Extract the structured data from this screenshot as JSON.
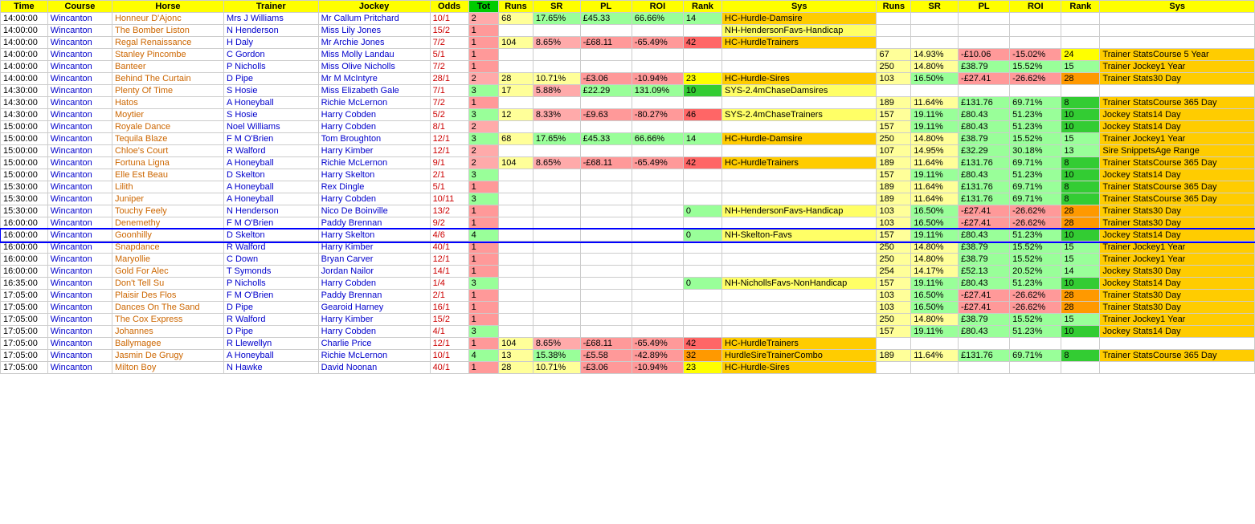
{
  "headers": {
    "time": "Time",
    "course": "Course",
    "horse": "Horse",
    "trainer": "Trainer",
    "jockey": "Jockey",
    "odds": "Odds",
    "tot": "Tot",
    "runs1": "Runs",
    "sr1": "SR",
    "pl1": "PL",
    "roi1": "ROI",
    "rank1": "Rank",
    "sys1": "Sys",
    "runs2": "Runs",
    "sr2": "SR",
    "pl2": "PL",
    "roi2": "ROI",
    "rank2": "Rank",
    "sys2": "Sys"
  },
  "rows": [
    {
      "time": "14:00:00",
      "course": "Wincanton",
      "horse": "Honneur D'Ajonc",
      "trainer": "Mrs J Williams",
      "jockey": "Mr Callum Pritchard",
      "odds": "10/1",
      "tot": "2",
      "tot_class": "tot-salmon",
      "runs1": "68",
      "sr1": "17.65%",
      "pl1": "£45.33",
      "roi1": "66.66%",
      "rank1": "14",
      "sys1": "HC-Hurdle-Damsire",
      "runs2": "",
      "sr2": "",
      "pl2": "",
      "roi2": "",
      "rank2": "",
      "sys2": ""
    },
    {
      "time": "14:00:00",
      "course": "Wincanton",
      "horse": "The Bomber Liston",
      "trainer": "N Henderson",
      "jockey": "Miss Lily Jones",
      "odds": "15/2",
      "tot": "1",
      "tot_class": "tot-salmon",
      "runs1": "",
      "sr1": "",
      "pl1": "",
      "roi1": "",
      "rank1": "",
      "sys1": "NH-HendersonFavs-Handicap",
      "runs2": "",
      "sr2": "",
      "pl2": "",
      "roi2": "",
      "rank2": "",
      "sys2": ""
    },
    {
      "time": "14:00:00",
      "course": "Wincanton",
      "horse": "Regal Renaissance",
      "trainer": "H Daly",
      "jockey": "Mr Archie Jones",
      "odds": "7/2",
      "tot": "1",
      "tot_class": "tot-salmon",
      "runs1": "104",
      "sr1": "8.65%",
      "pl1": "-£68.11",
      "roi1": "-65.49%",
      "rank1": "42",
      "sys1": "HC-HurdleTrainers",
      "runs2": "",
      "sr2": "",
      "pl2": "",
      "roi2": "",
      "rank2": "",
      "sys2": ""
    },
    {
      "time": "14:00:00",
      "course": "Wincanton",
      "horse": "Stanley Pincombe",
      "trainer": "C Gordon",
      "jockey": "Miss Molly Landau",
      "odds": "5/1",
      "tot": "1",
      "tot_class": "tot-salmon",
      "runs1": "",
      "sr1": "",
      "pl1": "",
      "roi1": "",
      "rank1": "",
      "sys1": "",
      "runs2": "67",
      "sr2": "14.93%",
      "pl2": "-£10.06",
      "roi2": "-15.02%",
      "rank2": "24",
      "sys2": "Trainer StatsCourse 5 Year"
    },
    {
      "time": "14:00:00",
      "course": "Wincanton",
      "horse": "Banteer",
      "trainer": "P Nicholls",
      "jockey": "Miss Olive Nicholls",
      "odds": "7/2",
      "tot": "1",
      "tot_class": "tot-salmon",
      "runs1": "",
      "sr1": "",
      "pl1": "",
      "roi1": "",
      "rank1": "",
      "sys1": "",
      "runs2": "250",
      "sr2": "14.80%",
      "pl2": "£38.79",
      "roi2": "15.52%",
      "rank2": "15",
      "sys2": "Trainer Jockey1 Year"
    },
    {
      "time": "14:00:00",
      "course": "Wincanton",
      "horse": "Behind The Curtain",
      "trainer": "D Pipe",
      "jockey": "Mr M McIntyre",
      "odds": "28/1",
      "tot": "2",
      "tot_class": "tot-salmon",
      "runs1": "28",
      "sr1": "10.71%",
      "pl1": "-£3.06",
      "roi1": "-10.94%",
      "rank1": "23",
      "sys1": "HC-Hurdle-Sires",
      "runs2": "103",
      "sr2": "16.50%",
      "pl2": "-£27.41",
      "roi2": "-26.62%",
      "rank2": "28",
      "sys2": "Trainer Stats30 Day"
    },
    {
      "time": "14:30:00",
      "course": "Wincanton",
      "horse": "Plenty Of Time",
      "trainer": "S Hosie",
      "jockey": "Miss Elizabeth Gale",
      "odds": "7/1",
      "tot": "3",
      "tot_class": "tot-green",
      "runs1": "17",
      "sr1": "5.88%",
      "pl1": "£22.29",
      "roi1": "131.09%",
      "rank1": "10",
      "sys1": "SYS-2.4mChaseDamsires",
      "runs2": "",
      "sr2": "",
      "pl2": "",
      "roi2": "",
      "rank2": "",
      "sys2": ""
    },
    {
      "time": "14:30:00",
      "course": "Wincanton",
      "horse": "Hatos",
      "trainer": "A Honeyball",
      "jockey": "Richie McLernon",
      "odds": "7/2",
      "tot": "1",
      "tot_class": "tot-salmon",
      "runs1": "",
      "sr1": "",
      "pl1": "",
      "roi1": "",
      "rank1": "",
      "sys1": "",
      "runs2": "189",
      "sr2": "11.64%",
      "pl2": "£131.76",
      "roi2": "69.71%",
      "rank2": "8",
      "sys2": "Trainer StatsCourse 365 Day"
    },
    {
      "time": "14:30:00",
      "course": "Wincanton",
      "horse": "Moytier",
      "trainer": "S Hosie",
      "jockey": "Harry Cobden",
      "odds": "5/2",
      "tot": "3",
      "tot_class": "tot-green",
      "runs1": "12",
      "sr1": "8.33%",
      "pl1": "-£9.63",
      "roi1": "-80.27%",
      "rank1": "46",
      "sys1": "SYS-2.4mChaseTrainers",
      "runs2": "157",
      "sr2": "19.11%",
      "pl2": "£80.43",
      "roi2": "51.23%",
      "rank2": "10",
      "sys2": "Jockey Stats14 Day"
    },
    {
      "time": "15:00:00",
      "course": "Wincanton",
      "horse": "Royale Dance",
      "trainer": "Noel Williams",
      "jockey": "Harry Cobden",
      "odds": "8/1",
      "tot": "2",
      "tot_class": "tot-salmon",
      "runs1": "",
      "sr1": "",
      "pl1": "",
      "roi1": "",
      "rank1": "",
      "sys1": "",
      "runs2": "157",
      "sr2": "19.11%",
      "pl2": "£80.43",
      "roi2": "51.23%",
      "rank2": "10",
      "sys2": "Jockey Stats14 Day"
    },
    {
      "time": "15:00:00",
      "course": "Wincanton",
      "horse": "Tequila Blaze",
      "trainer": "F M O'Brien",
      "jockey": "Tom Broughton",
      "odds": "12/1",
      "tot": "3",
      "tot_class": "tot-green",
      "runs1": "68",
      "sr1": "17.65%",
      "pl1": "£45.33",
      "roi1": "66.66%",
      "rank1": "14",
      "sys1": "HC-Hurdle-Damsire",
      "runs2": "250",
      "sr2": "14.80%",
      "pl2": "£38.79",
      "roi2": "15.52%",
      "rank2": "15",
      "sys2": "Trainer Jockey1 Year"
    },
    {
      "time": "15:00:00",
      "course": "Wincanton",
      "horse": "Chloe's Court",
      "trainer": "R Walford",
      "jockey": "Harry Kimber",
      "odds": "12/1",
      "tot": "2",
      "tot_class": "tot-salmon",
      "runs1": "",
      "sr1": "",
      "pl1": "",
      "roi1": "",
      "rank1": "",
      "sys1": "",
      "runs2": "107",
      "sr2": "14.95%",
      "pl2": "£32.29",
      "roi2": "30.18%",
      "rank2": "13",
      "sys2": "Sire SnippetsAge Range"
    },
    {
      "time": "15:00:00",
      "course": "Wincanton",
      "horse": "Fortuna Ligna",
      "trainer": "A Honeyball",
      "jockey": "Richie McLernon",
      "odds": "9/1",
      "tot": "2",
      "tot_class": "tot-salmon",
      "runs1": "104",
      "sr1": "8.65%",
      "pl1": "-£68.11",
      "roi1": "-65.49%",
      "rank1": "42",
      "sys1": "HC-HurdleTrainers",
      "runs2": "189",
      "sr2": "11.64%",
      "pl2": "£131.76",
      "roi2": "69.71%",
      "rank2": "8",
      "sys2": "Trainer StatsCourse 365 Day"
    },
    {
      "time": "15:00:00",
      "course": "Wincanton",
      "horse": "Elle Est Beau",
      "trainer": "D Skelton",
      "jockey": "Harry Skelton",
      "odds": "2/1",
      "tot": "3",
      "tot_class": "tot-green",
      "runs1": "",
      "sr1": "",
      "pl1": "",
      "roi1": "",
      "rank1": "",
      "sys1": "",
      "runs2": "157",
      "sr2": "19.11%",
      "pl2": "£80.43",
      "roi2": "51.23%",
      "rank2": "10",
      "sys2": "Jockey Stats14 Day"
    },
    {
      "time": "15:30:00",
      "course": "Wincanton",
      "horse": "Lilith",
      "trainer": "A Honeyball",
      "jockey": "Rex Dingle",
      "odds": "5/1",
      "tot": "1",
      "tot_class": "tot-salmon",
      "runs1": "",
      "sr1": "",
      "pl1": "",
      "roi1": "",
      "rank1": "",
      "sys1": "",
      "runs2": "189",
      "sr2": "11.64%",
      "pl2": "£131.76",
      "roi2": "69.71%",
      "rank2": "8",
      "sys2": "Trainer StatsCourse 365 Day"
    },
    {
      "time": "15:30:00",
      "course": "Wincanton",
      "horse": "Juniper",
      "trainer": "A Honeyball",
      "jockey": "Harry Cobden",
      "odds": "10/11",
      "tot": "3",
      "tot_class": "tot-green",
      "runs1": "",
      "sr1": "",
      "pl1": "",
      "roi1": "",
      "rank1": "",
      "sys1": "",
      "runs2": "189",
      "sr2": "11.64%",
      "pl2": "£131.76",
      "roi2": "69.71%",
      "rank2": "8",
      "sys2": "Trainer StatsCourse 365 Day"
    },
    {
      "time": "15:30:00",
      "course": "Wincanton",
      "horse": "Touchy Feely",
      "trainer": "N Henderson",
      "jockey": "Nico De Boinville",
      "odds": "13/2",
      "tot": "1",
      "tot_class": "tot-salmon",
      "runs1": "",
      "sr1": "",
      "pl1": "",
      "roi1": "",
      "rank1": "0",
      "sys1": "NH-HendersonFavs-Handicap",
      "runs2": "103",
      "sr2": "16.50%",
      "pl2": "-£27.41",
      "roi2": "-26.62%",
      "rank2": "28",
      "sys2": "Trainer Stats30 Day"
    },
    {
      "time": "16:00:00",
      "course": "Wincanton",
      "horse": "Denemethy",
      "trainer": "F M O'Brien",
      "jockey": "Paddy Brennan",
      "odds": "9/2",
      "tot": "1",
      "tot_class": "tot-salmon",
      "runs1": "",
      "sr1": "",
      "pl1": "",
      "roi1": "",
      "rank1": "",
      "sys1": "",
      "runs2": "103",
      "sr2": "16.50%",
      "pl2": "-£27.41",
      "roi2": "-26.62%",
      "rank2": "28",
      "sys2": "Trainer Stats30 Day"
    },
    {
      "time": "16:00:00",
      "course": "Wincanton",
      "horse": "Goonhilly",
      "trainer": "D Skelton",
      "jockey": "Harry Skelton",
      "odds": "4/6",
      "tot": "4",
      "tot_class": "tot-green",
      "runs1": "",
      "sr1": "",
      "pl1": "",
      "roi1": "",
      "rank1": "0",
      "sys1": "NH-Skelton-Favs",
      "runs2": "157",
      "sr2": "19.11%",
      "pl2": "£80.43",
      "roi2": "51.23%",
      "rank2": "10",
      "sys2": "Jockey Stats14 Day",
      "blue_border": true
    },
    {
      "time": "16:00:00",
      "course": "Wincanton",
      "horse": "Snapdance",
      "trainer": "R Walford",
      "jockey": "Harry Kimber",
      "odds": "40/1",
      "tot": "1",
      "tot_class": "tot-salmon",
      "runs1": "",
      "sr1": "",
      "pl1": "",
      "roi1": "",
      "rank1": "",
      "sys1": "",
      "runs2": "250",
      "sr2": "14.80%",
      "pl2": "£38.79",
      "roi2": "15.52%",
      "rank2": "15",
      "sys2": "Trainer Jockey1 Year"
    },
    {
      "time": "16:00:00",
      "course": "Wincanton",
      "horse": "Maryollie",
      "trainer": "C Down",
      "jockey": "Bryan Carver",
      "odds": "12/1",
      "tot": "1",
      "tot_class": "tot-salmon",
      "runs1": "",
      "sr1": "",
      "pl1": "",
      "roi1": "",
      "rank1": "",
      "sys1": "",
      "runs2": "250",
      "sr2": "14.80%",
      "pl2": "£38.79",
      "roi2": "15.52%",
      "rank2": "15",
      "sys2": "Trainer Jockey1 Year"
    },
    {
      "time": "16:00:00",
      "course": "Wincanton",
      "horse": "Gold For Alec",
      "trainer": "T Symonds",
      "jockey": "Jordan Nailor",
      "odds": "14/1",
      "tot": "1",
      "tot_class": "tot-salmon",
      "runs1": "",
      "sr1": "",
      "pl1": "",
      "roi1": "",
      "rank1": "",
      "sys1": "",
      "runs2": "254",
      "sr2": "14.17%",
      "pl2": "£52.13",
      "roi2": "20.52%",
      "rank2": "14",
      "sys2": "Jockey Stats30 Day"
    },
    {
      "time": "16:35:00",
      "course": "Wincanton",
      "horse": "Don't Tell Su",
      "trainer": "P Nicholls",
      "jockey": "Harry Cobden",
      "odds": "1/4",
      "tot": "3",
      "tot_class": "tot-green",
      "runs1": "",
      "sr1": "",
      "pl1": "",
      "roi1": "",
      "rank1": "0",
      "sys1": "NH-NichollsFavs-NonHandicap",
      "runs2": "157",
      "sr2": "19.11%",
      "pl2": "£80.43",
      "roi2": "51.23%",
      "rank2": "10",
      "sys2": "Jockey Stats14 Day"
    },
    {
      "time": "17:05:00",
      "course": "Wincanton",
      "horse": "Plaisir Des Flos",
      "trainer": "F M O'Brien",
      "jockey": "Paddy Brennan",
      "odds": "2/1",
      "tot": "1",
      "tot_class": "tot-salmon",
      "runs1": "",
      "sr1": "",
      "pl1": "",
      "roi1": "",
      "rank1": "",
      "sys1": "",
      "runs2": "103",
      "sr2": "16.50%",
      "pl2": "-£27.41",
      "roi2": "-26.62%",
      "rank2": "28",
      "sys2": "Trainer Stats30 Day"
    },
    {
      "time": "17:05:00",
      "course": "Wincanton",
      "horse": "Dances On The Sand",
      "trainer": "D Pipe",
      "jockey": "Gearoid Harney",
      "odds": "16/1",
      "tot": "1",
      "tot_class": "tot-salmon",
      "runs1": "",
      "sr1": "",
      "pl1": "",
      "roi1": "",
      "rank1": "",
      "sys1": "",
      "runs2": "103",
      "sr2": "16.50%",
      "pl2": "-£27.41",
      "roi2": "-26.62%",
      "rank2": "28",
      "sys2": "Trainer Stats30 Day"
    },
    {
      "time": "17:05:00",
      "course": "Wincanton",
      "horse": "The Cox Express",
      "trainer": "R Walford",
      "jockey": "Harry Kimber",
      "odds": "15/2",
      "tot": "1",
      "tot_class": "tot-salmon",
      "runs1": "",
      "sr1": "",
      "pl1": "",
      "roi1": "",
      "rank1": "",
      "sys1": "",
      "runs2": "250",
      "sr2": "14.80%",
      "pl2": "£38.79",
      "roi2": "15.52%",
      "rank2": "15",
      "sys2": "Trainer Jockey1 Year"
    },
    {
      "time": "17:05:00",
      "course": "Wincanton",
      "horse": "Johannes",
      "trainer": "D Pipe",
      "jockey": "Harry Cobden",
      "odds": "4/1",
      "tot": "3",
      "tot_class": "tot-green",
      "runs1": "",
      "sr1": "",
      "pl1": "",
      "roi1": "",
      "rank1": "",
      "sys1": "",
      "runs2": "157",
      "sr2": "19.11%",
      "pl2": "£80.43",
      "roi2": "51.23%",
      "rank2": "10",
      "sys2": "Jockey Stats14 Day"
    },
    {
      "time": "17:05:00",
      "course": "Wincanton",
      "horse": "Ballymagee",
      "trainer": "R Llewellyn",
      "jockey": "Charlie Price",
      "odds": "12/1",
      "tot": "1",
      "tot_class": "tot-salmon",
      "runs1": "104",
      "sr1": "8.65%",
      "pl1": "-£68.11",
      "roi1": "-65.49%",
      "rank1": "42",
      "sys1": "HC-HurdleTrainers",
      "runs2": "",
      "sr2": "",
      "pl2": "",
      "roi2": "",
      "rank2": "",
      "sys2": ""
    },
    {
      "time": "17:05:00",
      "course": "Wincanton",
      "horse": "Jasmin De Grugy",
      "trainer": "A Honeyball",
      "jockey": "Richie McLernon",
      "odds": "10/1",
      "tot": "4",
      "tot_class": "tot-green",
      "runs1": "13",
      "sr1": "15.38%",
      "pl1": "-£5.58",
      "roi1": "-42.89%",
      "rank1": "32",
      "sys1": "HurdleSireTrainerCombo",
      "runs2": "189",
      "sr2": "11.64%",
      "pl2": "£131.76",
      "roi2": "69.71%",
      "rank2": "8",
      "sys2": "Trainer StatsCourse 365 Day"
    },
    {
      "time": "17:05:00",
      "course": "Wincanton",
      "horse": "Milton Boy",
      "trainer": "N Hawke",
      "jockey": "David Noonan",
      "odds": "40/1",
      "tot": "1",
      "tot_class": "tot-salmon",
      "runs1": "28",
      "sr1": "10.71%",
      "pl1": "-£3.06",
      "roi1": "-10.94%",
      "rank1": "23",
      "sys1": "HC-Hurdle-Sires",
      "runs2": "",
      "sr2": "",
      "pl2": "",
      "roi2": "",
      "rank2": "",
      "sys2": ""
    }
  ]
}
